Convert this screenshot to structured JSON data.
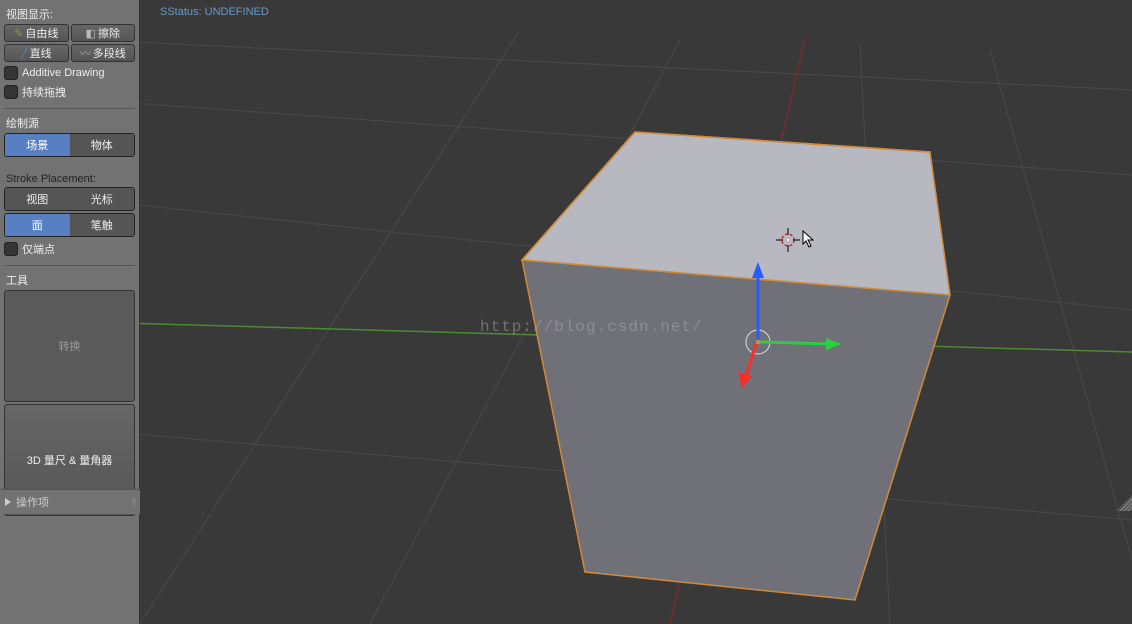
{
  "viewport": {
    "status": "SStatus: UNDEFINED",
    "watermark": "http://blog.csdn.net/"
  },
  "panel": {
    "view_display": "视图显示:",
    "tools": {
      "freehand": "自由线",
      "erase": "擦除",
      "line": "直线",
      "poly": "多段线"
    },
    "additive": "Additive Drawing",
    "continuous": "持续拖拽",
    "draw_source_label": "绘制源",
    "source_scene": "场景",
    "source_object": "物体",
    "stroke_placement_label": "Stroke Placement:",
    "sp_view": "视图",
    "sp_cursor": "光标",
    "sp_surface": "面",
    "sp_stroke": "笔触",
    "only_endpoints": "仅端点",
    "tools_label": "工具",
    "transform": "转换",
    "ruler": "3D 量尺 & 量角器",
    "operations": "操作项"
  }
}
